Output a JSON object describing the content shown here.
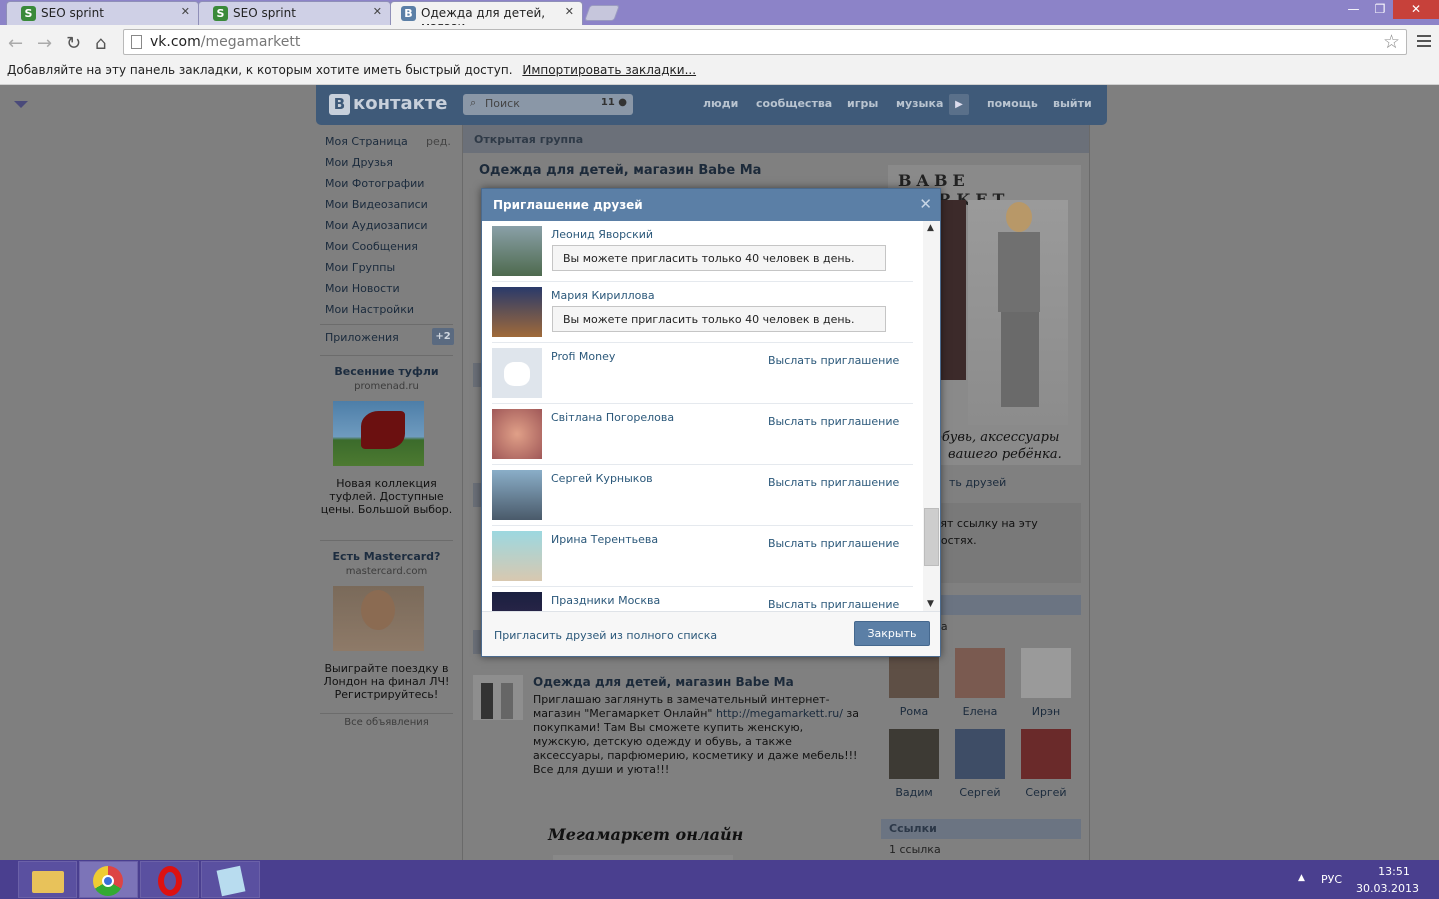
{
  "browser": {
    "tabs": [
      {
        "title": "SEO sprint",
        "icon": "seo-sprint-favicon"
      },
      {
        "title": "SEO sprint",
        "icon": "seo-sprint-favicon"
      },
      {
        "title": "Одежда для детей, магази",
        "icon": "vk-favicon"
      }
    ],
    "url_host": "vk.com",
    "url_path": "/megamarkett",
    "bookmarks_text": "Добавляйте на эту панель закладки, к которым хотите иметь быстрый доступ.",
    "bookmarks_link": "Импортировать закладки..."
  },
  "vk": {
    "logo": "контакте",
    "logo_letter": "В",
    "search_placeholder": "Поиск",
    "search_count": "11",
    "nav": [
      "люди",
      "сообщества",
      "игры",
      "музыка",
      "помощь",
      "выйти"
    ],
    "left_menu": [
      "Моя Страница",
      "Мои Друзья",
      "Мои Фотографии",
      "Мои Видеозаписи",
      "Мои Аудиозаписи",
      "Мои Сообщения",
      "Мои Группы",
      "Мои Новости",
      "Мои Настройки"
    ],
    "edit_label": "ред.",
    "apps_label": "Приложения",
    "apps_badge": "+2",
    "ads": [
      {
        "title": "Весенние туфли",
        "domain": "promenad.ru",
        "text": "Новая коллекция туфлей. Доступные цены. Большой выбор."
      },
      {
        "title": "Есть Mastercard?",
        "domain": "mastercard.com",
        "text": "Выиграйте поездку в Лондон на финал ЛЧ! Регистрируйтесь!"
      }
    ],
    "all_ads": "Все объявления"
  },
  "group": {
    "type": "Открытая группа",
    "name": "Одежда для детей, магазин Babe Ma",
    "cover_title": "BABE MARKET",
    "cover_caption_1": "а, обувь, аксессуары",
    "cover_caption_2": "вашего ребёнка.",
    "invite_friends": "ть друзей",
    "share_text": "лья увидят ссылку на эту\nвоих Новостях.",
    "members_count": "века",
    "members": [
      "Рома",
      "Елена",
      "Ирэн",
      "Вадим",
      "Сергей",
      "Сергей"
    ],
    "links_title": "Ссылки",
    "links_count": "1 ссылка",
    "post": {
      "author": "Одежда для детей, магазин Babe Ma",
      "text_1": "Приглашаю заглянуть в замечательный интернет-магазин \"Мегамаркет Онлайн\" ",
      "link": "http://megamarkett.ru/",
      "text_2": " за покупками! Там Вы сможете купить женскую, мужскую, детскую одежду и обувь, а также аксессуары, парфюмерию, косметику и даже мебель!!! Все для души и уюта!!!",
      "promo": "Мегамаркет онлайн"
    }
  },
  "dialog": {
    "title": "Приглашение друзей",
    "limit_message": "Вы можете пригласить только 40 человек в день.",
    "send_label": "Выслать приглашение",
    "friends": [
      {
        "name": "Леонид Яворский",
        "state": "limit"
      },
      {
        "name": "Мария Кириллова",
        "state": "limit"
      },
      {
        "name": "Profi Money",
        "state": "send"
      },
      {
        "name": "Світлана Погорелова",
        "state": "send"
      },
      {
        "name": "Сергей Курныков",
        "state": "send"
      },
      {
        "name": "Ирина Терентьева",
        "state": "send"
      },
      {
        "name": "Праздники Москва",
        "state": "send"
      }
    ],
    "full_list": "Пригласить друзей из полного списка",
    "close": "Закрыть"
  },
  "taskbar": {
    "apps": [
      "file-explorer",
      "chrome",
      "opera",
      "notepad"
    ],
    "lang": "РУС",
    "time": "13:51",
    "date": "30.03.2013"
  }
}
